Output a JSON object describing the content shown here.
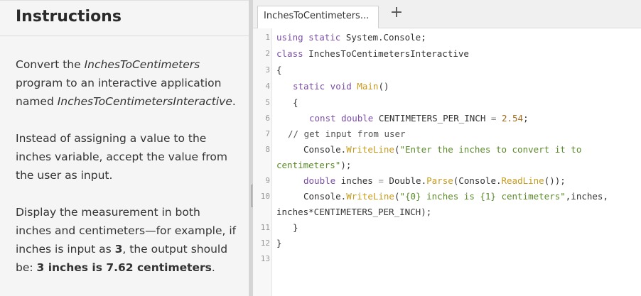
{
  "instructions": {
    "title": "Instructions",
    "p1": [
      "Convert the ",
      "InchesToCentimeters",
      " program to an interactive application named ",
      "InchesToCentimetersInteractive",
      "."
    ],
    "p2": "Instead of assigning a value to the inches variable, accept the value from the user as input.",
    "p3": [
      "Display the measurement in both inches and centimeters—for example, if inches is input as ",
      "3",
      ", the output should be: ",
      "3 inches is 7.62 centimeters",
      "."
    ]
  },
  "tabs": {
    "active_label": "InchesToCentimeters...",
    "add_label": "+"
  },
  "editor": {
    "line_numbers": [
      "1",
      "2",
      "3",
      "4",
      "5",
      "6",
      "7",
      "8",
      "",
      "9",
      "10",
      "",
      "11",
      "12",
      "13"
    ]
  },
  "code": {
    "l1": [
      "using static",
      " System.Console;"
    ],
    "l2": [
      "class",
      " InchesToCentimetersInteractive"
    ],
    "l3": "{",
    "l4": [
      "static void",
      " ",
      "Main",
      "()"
    ],
    "l5": "{",
    "l6": [
      "const double",
      " CENTIMETERS_PER_INCH ",
      "=",
      " ",
      "2.54",
      ";"
    ],
    "l7": "// get input from user",
    "l8": [
      "Console.",
      "WriteLine",
      "(",
      "\"Enter the inches to convert it to"
    ],
    "l8b": [
      "centimeters\"",
      ");"
    ],
    "l9": [
      "double",
      " inches ",
      "=",
      " Double.",
      "Parse",
      "(Console.",
      "ReadLine",
      "());"
    ],
    "l10": [
      "Console.",
      "WriteLine",
      "(",
      "\"{0} inches is {1} centimeters\"",
      ",inches,"
    ],
    "l10b": "inches*CENTIMETERS_PER_INCH);",
    "l11": "}",
    "l12": "}"
  }
}
